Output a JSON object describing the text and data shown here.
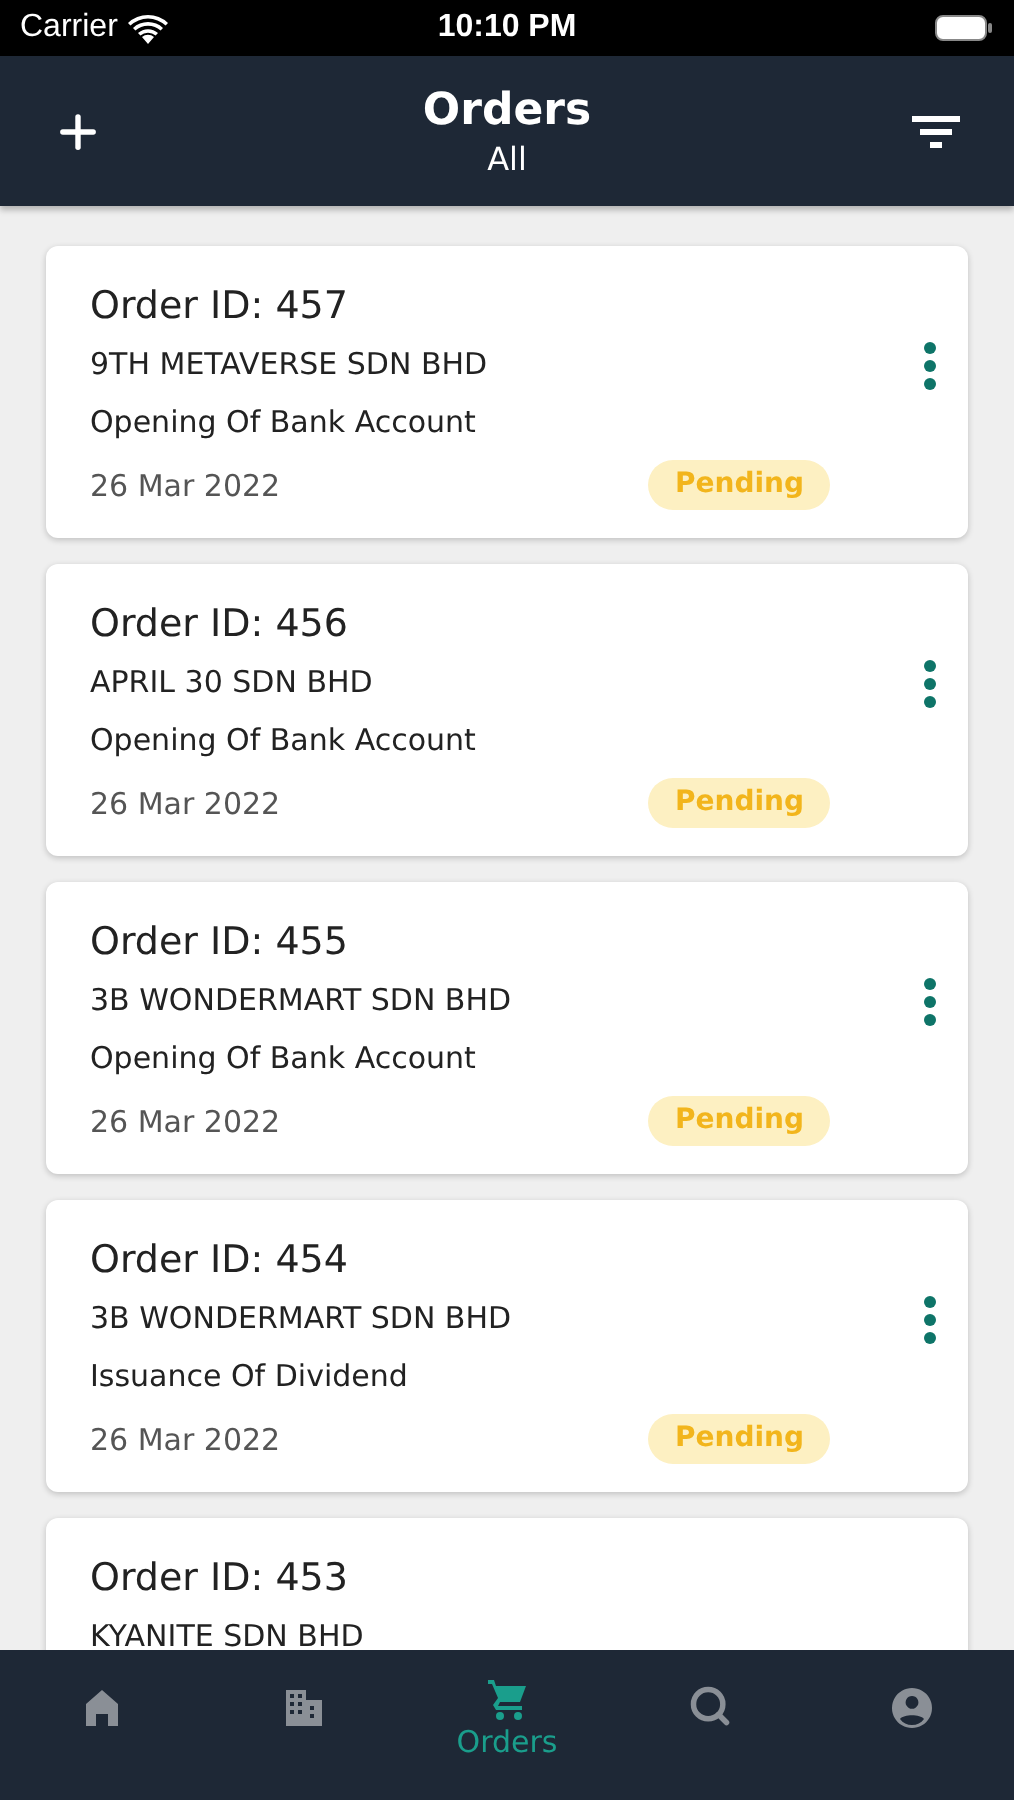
{
  "status_bar": {
    "carrier": "Carrier",
    "time": "10:10 PM"
  },
  "header": {
    "title": "Orders",
    "subtitle": "All"
  },
  "orders": [
    {
      "id": "Order ID: 457",
      "company": "9TH METAVERSE SDN BHD",
      "service": "Opening Of Bank Account",
      "date": "26 Mar 2022",
      "status": "Pending"
    },
    {
      "id": "Order ID: 456",
      "company": "APRIL 30 SDN BHD",
      "service": "Opening Of Bank Account",
      "date": "26 Mar 2022",
      "status": "Pending"
    },
    {
      "id": "Order ID: 455",
      "company": "3B WONDERMART SDN BHD",
      "service": "Opening Of Bank Account",
      "date": "26 Mar 2022",
      "status": "Pending"
    },
    {
      "id": "Order ID: 454",
      "company": "3B WONDERMART SDN BHD",
      "service": "Issuance Of Dividend",
      "date": "26 Mar 2022",
      "status": "Pending"
    },
    {
      "id": "Order ID: 453",
      "company": "KYANITE SDN BHD"
    }
  ],
  "tabs": [
    {
      "kind": "home",
      "selected": false
    },
    {
      "kind": "buildings",
      "selected": false
    },
    {
      "kind": "cart",
      "label": "Orders",
      "selected": true
    },
    {
      "kind": "search",
      "selected": false
    },
    {
      "kind": "account",
      "selected": false
    }
  ]
}
